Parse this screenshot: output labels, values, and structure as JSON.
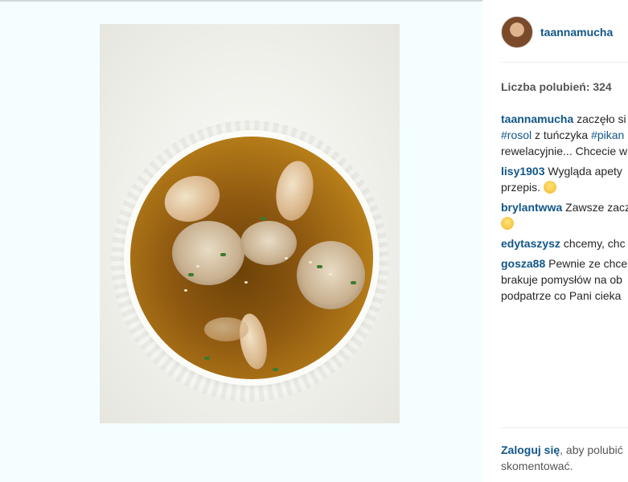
{
  "post": {
    "username": "taannamucha",
    "likes_text": "Liczba polubień: 324",
    "photo_alt": "soup",
    "comments": [
      {
        "user": "taannamucha",
        "lines": [
          "zaczęło si",
          "#rosol z tuńczyka #pikan",
          "rewelacyjnie... Chcecie w"
        ],
        "tags": [
          "#rosol",
          "#pikan"
        ]
      },
      {
        "user": "lisy1903",
        "lines": [
          "Wygląda apety",
          "przepis."
        ],
        "emoji": "smile-emoji"
      },
      {
        "user": "brylantwwa",
        "lines": [
          "Zawsze zacz"
        ],
        "emoji": "wink-emoji"
      },
      {
        "user": "edytaszysz",
        "lines": [
          "chcemy, chc"
        ]
      },
      {
        "user": "gosza88",
        "lines": [
          "Pewnie ze chce",
          "brakuje pomysłów na ob",
          "podpatrze co Pani cieka"
        ]
      }
    ],
    "login": {
      "link": "Zaloguj się",
      "text1": ", aby polubić",
      "text2": "skomentować."
    }
  },
  "colors": {
    "link": "#125688",
    "background": "#f4fefe"
  }
}
